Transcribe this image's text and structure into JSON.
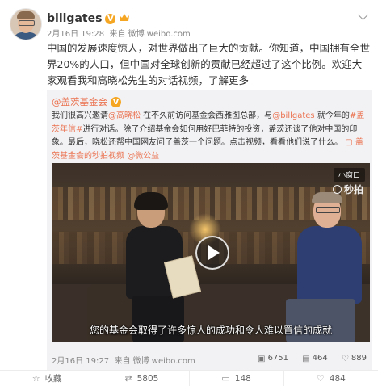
{
  "post": {
    "username": "billgates",
    "verified_badge": "V",
    "time": "2月16日 19:28",
    "source": "来自 微博 weibo.com",
    "text": "中国的发展速度惊人，对世界做出了巨大的贡献。你知道，中国拥有全世界20%的人口，但中国对全球创新的贡献已经超过了这个比例。欢迎大家观看我和高晓松先生的对话视频，了解更多"
  },
  "repost": {
    "author": "@盖茨基金会",
    "verified_badge": "V",
    "text_1": "我们很高兴邀请",
    "mention_1": "@高晓松",
    "text_2": " 在不久前访问基金会西雅图总部，与",
    "mention_2": "@billgates",
    "text_3": " 就今年的",
    "hashtag": "#盖茨年信#",
    "text_4": "进行对话。除了介绍基金会如何用好巴菲特的投资，盖茨还谈了他对中国的印象。最后，晓松还帮中国网友问了盖茨一个问题。点击视频，看看他们说了什么。",
    "video_link": "盖茨基金会的秒拍视频",
    "mention_3": "@微公益",
    "video": {
      "mini_window_label": "小窗口",
      "watermark": "秒拍",
      "subtitle": "您的基金会取得了许多惊人的成功和令人难以置信的成就"
    },
    "time": "2月16日 19:27",
    "source": "来自 微博 weibo.com",
    "stats": {
      "views": "6751",
      "reposts": "464",
      "likes": "889"
    }
  },
  "actions": {
    "favorite": "收藏",
    "repost": "5805",
    "comment": "148",
    "like": "484"
  },
  "colors": {
    "link": "#eb7350",
    "badge": "#f5a623",
    "quote_bg": "#f2f2f5"
  },
  "icons": [
    "chevron-down-icon",
    "crown-icon",
    "play-icon",
    "miaopai-logo-icon",
    "star-icon",
    "repost-icon",
    "comment-icon",
    "like-icon"
  ]
}
